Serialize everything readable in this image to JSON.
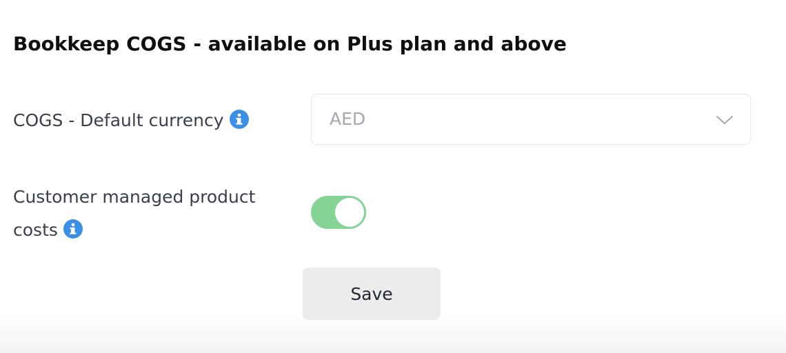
{
  "section": {
    "title": "Bookkeep COGS - available on Plus plan and above"
  },
  "currency_setting": {
    "label": "COGS - Default currency",
    "selected_value": "AED",
    "info_icon": "info-icon"
  },
  "costs_setting": {
    "label_line1": "Customer managed product",
    "label_line2": "costs",
    "toggle_state": "on",
    "info_icon": "info-icon"
  },
  "actions": {
    "save_label": "Save"
  },
  "colors": {
    "toggle_on": "#85d495",
    "info_icon": "#3d8fe3",
    "button_bg": "#ececec"
  }
}
